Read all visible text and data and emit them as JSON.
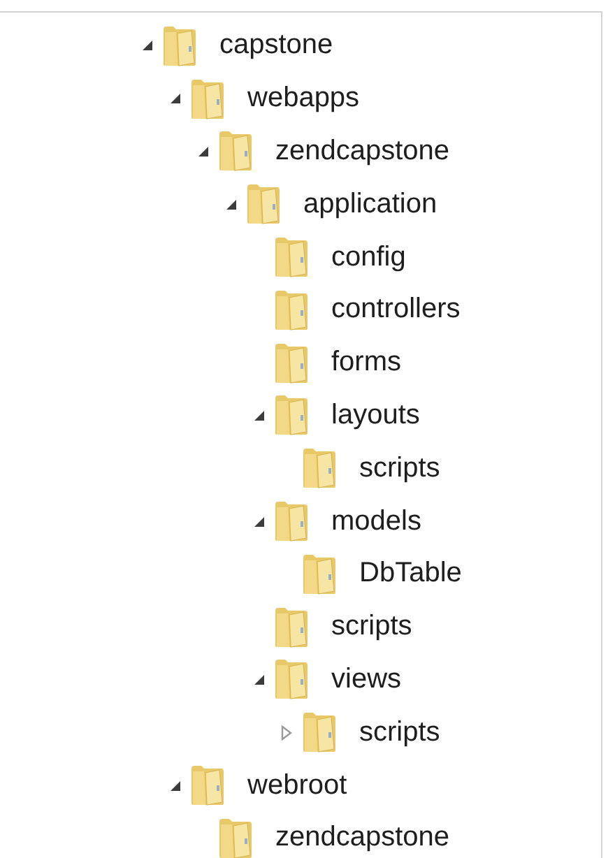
{
  "tree": [
    {
      "label": "capstone",
      "expanded": true,
      "children": [
        {
          "label": "webapps",
          "expanded": true,
          "children": [
            {
              "label": "zendcapstone",
              "expanded": true,
              "children": [
                {
                  "label": "application",
                  "expanded": true,
                  "children": [
                    {
                      "label": "config"
                    },
                    {
                      "label": "controllers"
                    },
                    {
                      "label": "forms"
                    },
                    {
                      "label": "layouts",
                      "expanded": true,
                      "children": [
                        {
                          "label": "scripts"
                        }
                      ]
                    },
                    {
                      "label": "models",
                      "expanded": true,
                      "children": [
                        {
                          "label": "DbTable"
                        }
                      ]
                    },
                    {
                      "label": "scripts"
                    },
                    {
                      "label": "views",
                      "expanded": true,
                      "children": [
                        {
                          "label": "scripts",
                          "expanded": false
                        }
                      ]
                    }
                  ]
                }
              ]
            }
          ]
        },
        {
          "label": "webroot",
          "expanded": true,
          "children": [
            {
              "label": "zendcapstone"
            }
          ]
        }
      ]
    }
  ]
}
